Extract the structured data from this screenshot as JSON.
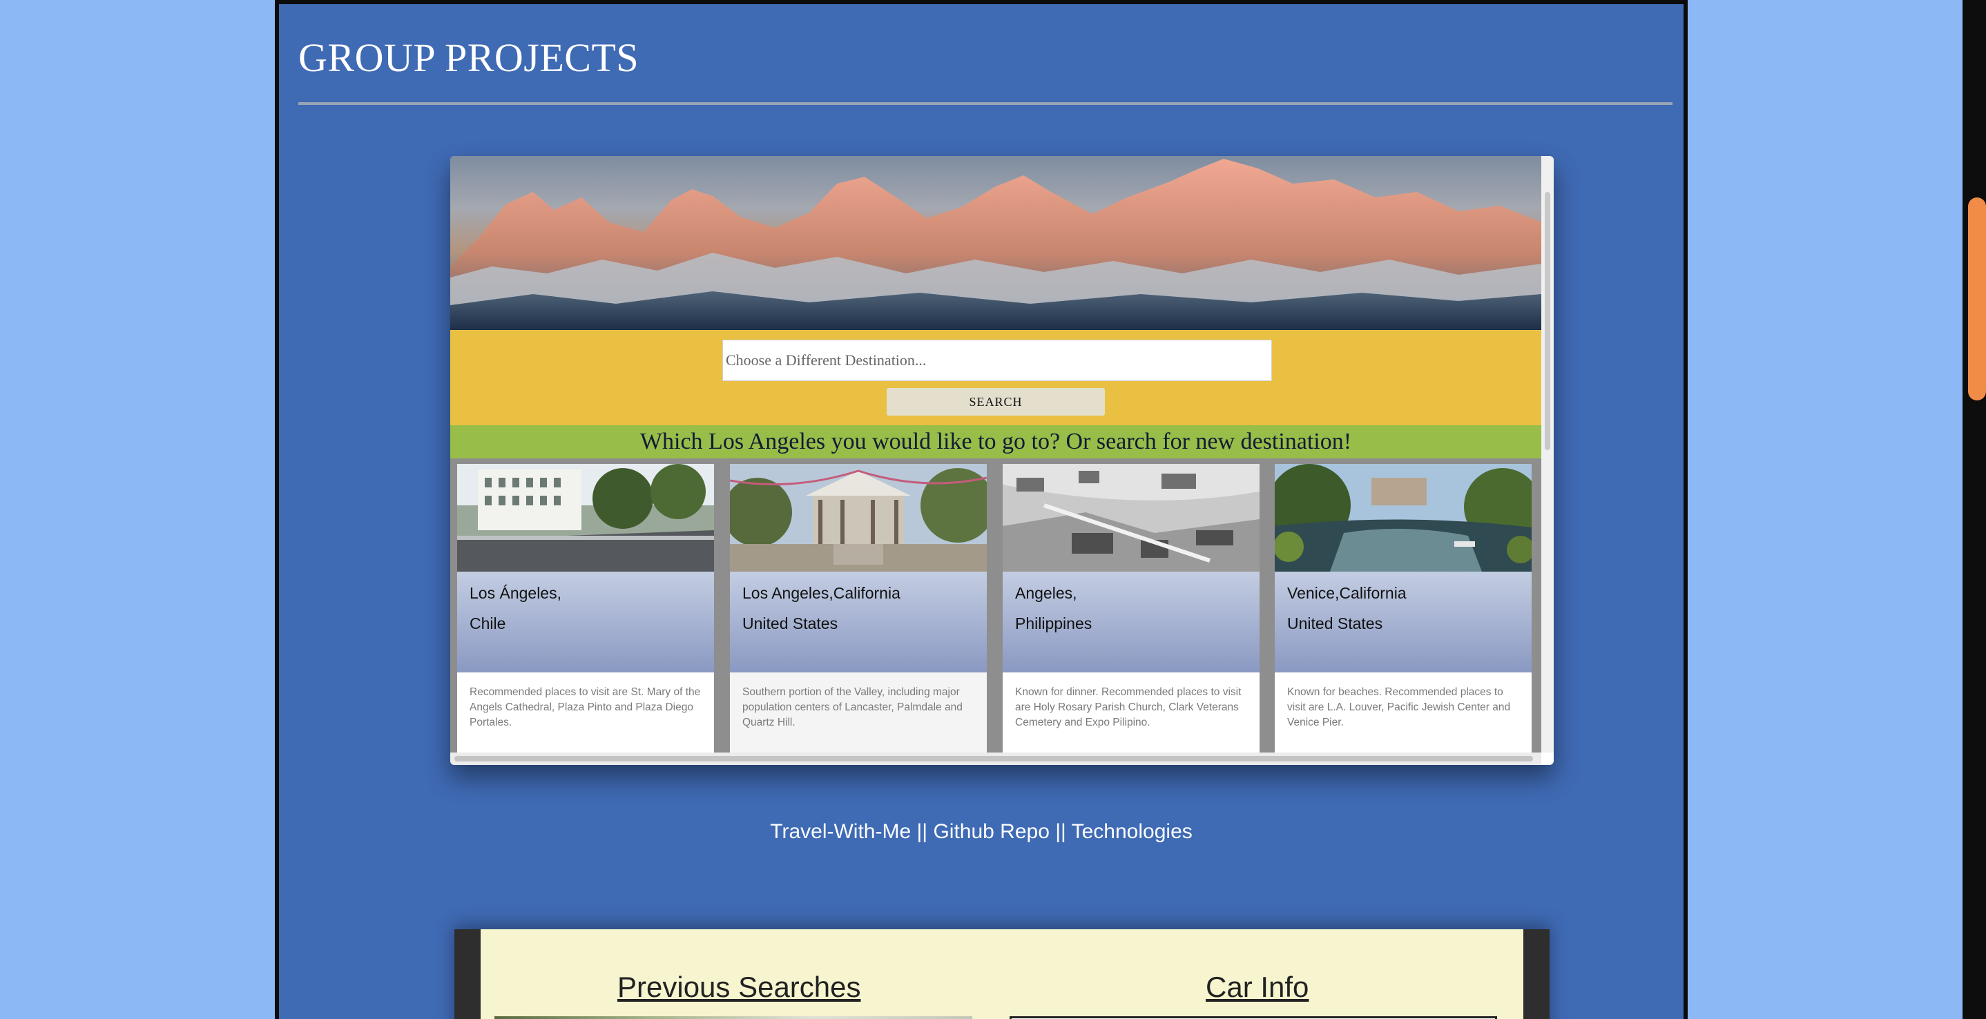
{
  "section": {
    "title": "GROUP PROJECTS"
  },
  "project": {
    "search": {
      "placeholder": "Choose a Different Destination...",
      "button_label": "SEARCH"
    },
    "prompt": "Which Los Angeles you would like to go to? Or search for new destination!",
    "cards": [
      {
        "city": "Los Ángeles,",
        "country": "Chile",
        "description": "Recommended places to visit are St. Mary of the Angels Cathedral, Plaza Pinto and Plaza Diego Portales."
      },
      {
        "city": "Los Angeles,California",
        "country": "United States",
        "description": "Southern portion of the Valley, including major population centers of Lancaster, Palmdale and Quartz Hill."
      },
      {
        "city": "Angeles,",
        "country": "Philippines",
        "description": "Known for dinner. Recommended places to visit are Holy Rosary Parish Church, Clark Veterans Cemetery and Expo Pilipino."
      },
      {
        "city": "Venice,California",
        "country": "United States",
        "description": "Known for beaches. Recommended places to visit are L.A. Louver, Pacific Jewish Center and Venice Pier."
      }
    ]
  },
  "links": {
    "live": "Travel-With-Me",
    "separator": "||",
    "repo": "Github Repo",
    "tech": "Technologies"
  },
  "project2": {
    "previous_title": "Previous Searches",
    "car_title": "Car Info"
  },
  "colors": {
    "page_bg": "#8db8f6",
    "section_bg": "#3f6ab4",
    "search_band": "#e9c042",
    "prompt_band": "#98bd48",
    "scroll_thumb": "#f08c47"
  }
}
